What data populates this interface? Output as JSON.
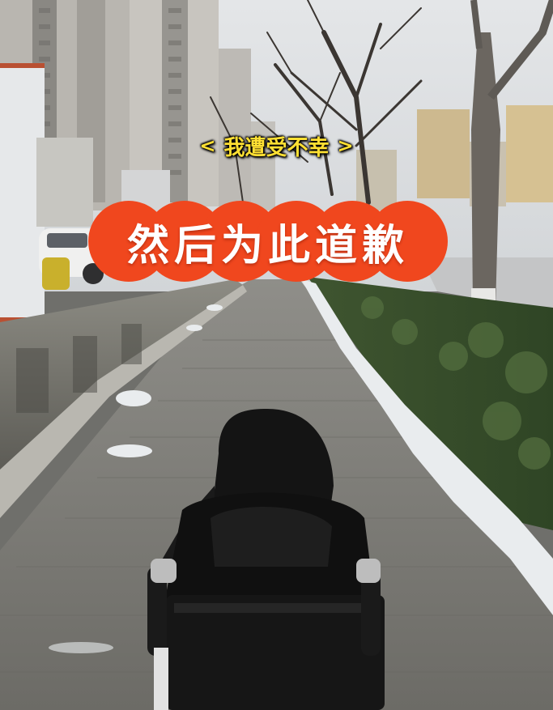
{
  "overlay": {
    "small_caption": "我遭受不幸",
    "small_caption_prefix": "<",
    "small_caption_suffix": ">",
    "main_caption": "然后为此道歉",
    "small_caption_color": "#ffe033",
    "main_caption_bg": "#f0471e",
    "main_caption_color": "#ffffff"
  }
}
